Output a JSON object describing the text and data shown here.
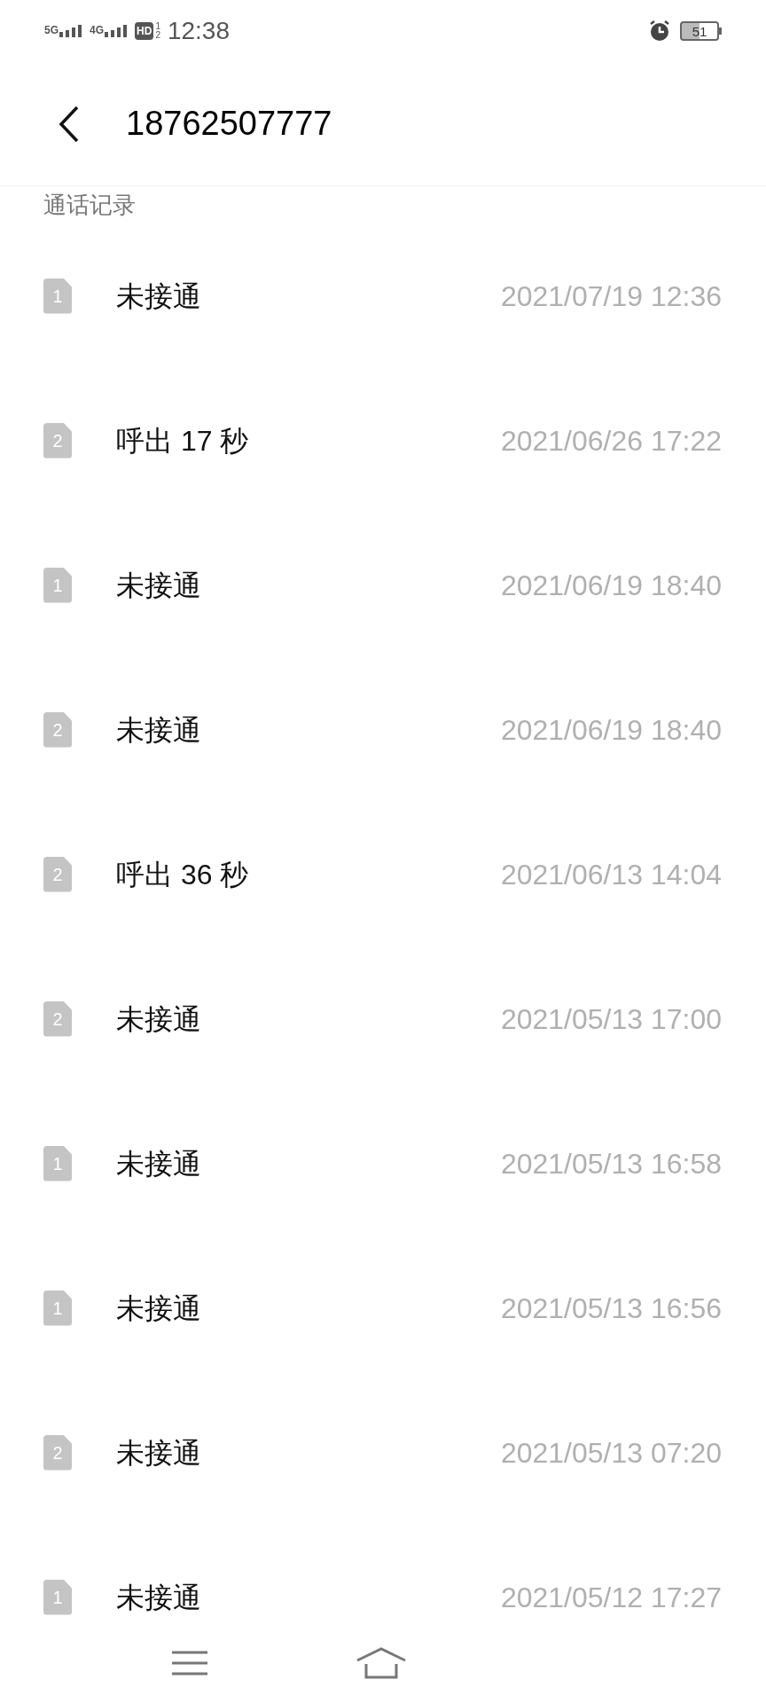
{
  "status_bar": {
    "network_1": "5G",
    "network_2": "4G",
    "hd": "HD",
    "hd_sim_1": "1",
    "hd_sim_2": "2",
    "time": "12:38",
    "battery": "51"
  },
  "header": {
    "title": "18762507777"
  },
  "section": {
    "title": "通话记录"
  },
  "calls": [
    {
      "sim": "1",
      "status": "未接通",
      "time": "2021/07/19 12:36"
    },
    {
      "sim": "2",
      "status": "呼出 17 秒",
      "time": "2021/06/26 17:22"
    },
    {
      "sim": "1",
      "status": "未接通",
      "time": "2021/06/19 18:40"
    },
    {
      "sim": "2",
      "status": "未接通",
      "time": "2021/06/19 18:40"
    },
    {
      "sim": "2",
      "status": "呼出 36 秒",
      "time": "2021/06/13 14:04"
    },
    {
      "sim": "2",
      "status": "未接通",
      "time": "2021/05/13 17:00"
    },
    {
      "sim": "1",
      "status": "未接通",
      "time": "2021/05/13 16:58"
    },
    {
      "sim": "1",
      "status": "未接通",
      "time": "2021/05/13 16:56"
    },
    {
      "sim": "2",
      "status": "未接通",
      "time": "2021/05/13 07:20"
    },
    {
      "sim": "1",
      "status": "未接通",
      "time": "2021/05/12 17:27"
    }
  ]
}
